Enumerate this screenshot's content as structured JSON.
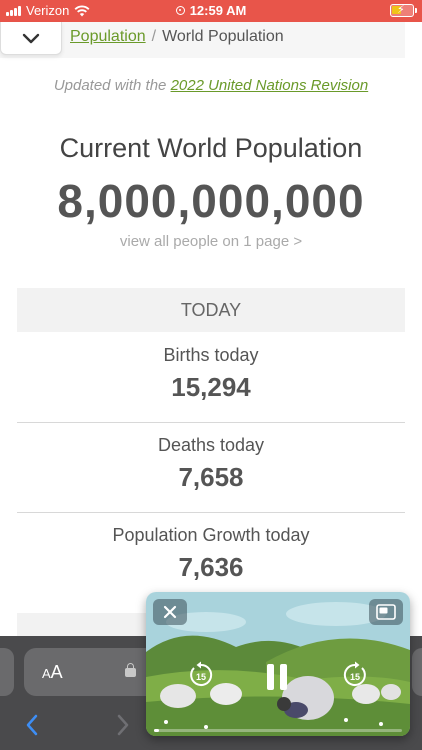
{
  "status": {
    "carrier": "Verizon",
    "time": "12:59 AM"
  },
  "breadcrumb": {
    "parent": "Population",
    "separator": "/",
    "current": "World Population"
  },
  "updated": {
    "prefix": "Updated with the ",
    "link": "2022 United Nations Revision"
  },
  "main": {
    "heading": "Current World Population",
    "counter": "8,000,000,000",
    "view_all": "view all people on 1 page >"
  },
  "today": {
    "header": "TODAY",
    "stats": [
      {
        "label": "Births today",
        "value": "15,294"
      },
      {
        "label": "Deaths today",
        "value": "7,658"
      },
      {
        "label": "Population Growth today",
        "value": "7,636"
      }
    ]
  },
  "safari": {
    "text_size_small": "A",
    "text_size_large": "A"
  },
  "pip": {
    "skip_back": "15",
    "skip_forward": "15",
    "progress": 0.02
  }
}
